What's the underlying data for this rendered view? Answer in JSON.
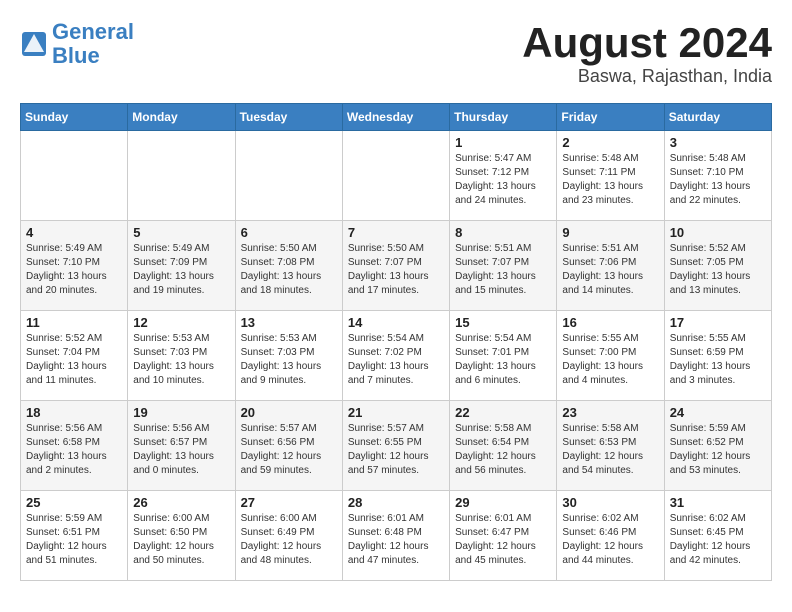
{
  "header": {
    "logo_line1": "General",
    "logo_line2": "Blue",
    "title": "August 2024",
    "subtitle": "Baswa, Rajasthan, India"
  },
  "weekdays": [
    "Sunday",
    "Monday",
    "Tuesday",
    "Wednesday",
    "Thursday",
    "Friday",
    "Saturday"
  ],
  "weeks": [
    [
      {
        "day": "",
        "info": ""
      },
      {
        "day": "",
        "info": ""
      },
      {
        "day": "",
        "info": ""
      },
      {
        "day": "",
        "info": ""
      },
      {
        "day": "1",
        "info": "Sunrise: 5:47 AM\nSunset: 7:12 PM\nDaylight: 13 hours\nand 24 minutes."
      },
      {
        "day": "2",
        "info": "Sunrise: 5:48 AM\nSunset: 7:11 PM\nDaylight: 13 hours\nand 23 minutes."
      },
      {
        "day": "3",
        "info": "Sunrise: 5:48 AM\nSunset: 7:10 PM\nDaylight: 13 hours\nand 22 minutes."
      }
    ],
    [
      {
        "day": "4",
        "info": "Sunrise: 5:49 AM\nSunset: 7:10 PM\nDaylight: 13 hours\nand 20 minutes."
      },
      {
        "day": "5",
        "info": "Sunrise: 5:49 AM\nSunset: 7:09 PM\nDaylight: 13 hours\nand 19 minutes."
      },
      {
        "day": "6",
        "info": "Sunrise: 5:50 AM\nSunset: 7:08 PM\nDaylight: 13 hours\nand 18 minutes."
      },
      {
        "day": "7",
        "info": "Sunrise: 5:50 AM\nSunset: 7:07 PM\nDaylight: 13 hours\nand 17 minutes."
      },
      {
        "day": "8",
        "info": "Sunrise: 5:51 AM\nSunset: 7:07 PM\nDaylight: 13 hours\nand 15 minutes."
      },
      {
        "day": "9",
        "info": "Sunrise: 5:51 AM\nSunset: 7:06 PM\nDaylight: 13 hours\nand 14 minutes."
      },
      {
        "day": "10",
        "info": "Sunrise: 5:52 AM\nSunset: 7:05 PM\nDaylight: 13 hours\nand 13 minutes."
      }
    ],
    [
      {
        "day": "11",
        "info": "Sunrise: 5:52 AM\nSunset: 7:04 PM\nDaylight: 13 hours\nand 11 minutes."
      },
      {
        "day": "12",
        "info": "Sunrise: 5:53 AM\nSunset: 7:03 PM\nDaylight: 13 hours\nand 10 minutes."
      },
      {
        "day": "13",
        "info": "Sunrise: 5:53 AM\nSunset: 7:03 PM\nDaylight: 13 hours\nand 9 minutes."
      },
      {
        "day": "14",
        "info": "Sunrise: 5:54 AM\nSunset: 7:02 PM\nDaylight: 13 hours\nand 7 minutes."
      },
      {
        "day": "15",
        "info": "Sunrise: 5:54 AM\nSunset: 7:01 PM\nDaylight: 13 hours\nand 6 minutes."
      },
      {
        "day": "16",
        "info": "Sunrise: 5:55 AM\nSunset: 7:00 PM\nDaylight: 13 hours\nand 4 minutes."
      },
      {
        "day": "17",
        "info": "Sunrise: 5:55 AM\nSunset: 6:59 PM\nDaylight: 13 hours\nand 3 minutes."
      }
    ],
    [
      {
        "day": "18",
        "info": "Sunrise: 5:56 AM\nSunset: 6:58 PM\nDaylight: 13 hours\nand 2 minutes."
      },
      {
        "day": "19",
        "info": "Sunrise: 5:56 AM\nSunset: 6:57 PM\nDaylight: 13 hours\nand 0 minutes."
      },
      {
        "day": "20",
        "info": "Sunrise: 5:57 AM\nSunset: 6:56 PM\nDaylight: 12 hours\nand 59 minutes."
      },
      {
        "day": "21",
        "info": "Sunrise: 5:57 AM\nSunset: 6:55 PM\nDaylight: 12 hours\nand 57 minutes."
      },
      {
        "day": "22",
        "info": "Sunrise: 5:58 AM\nSunset: 6:54 PM\nDaylight: 12 hours\nand 56 minutes."
      },
      {
        "day": "23",
        "info": "Sunrise: 5:58 AM\nSunset: 6:53 PM\nDaylight: 12 hours\nand 54 minutes."
      },
      {
        "day": "24",
        "info": "Sunrise: 5:59 AM\nSunset: 6:52 PM\nDaylight: 12 hours\nand 53 minutes."
      }
    ],
    [
      {
        "day": "25",
        "info": "Sunrise: 5:59 AM\nSunset: 6:51 PM\nDaylight: 12 hours\nand 51 minutes."
      },
      {
        "day": "26",
        "info": "Sunrise: 6:00 AM\nSunset: 6:50 PM\nDaylight: 12 hours\nand 50 minutes."
      },
      {
        "day": "27",
        "info": "Sunrise: 6:00 AM\nSunset: 6:49 PM\nDaylight: 12 hours\nand 48 minutes."
      },
      {
        "day": "28",
        "info": "Sunrise: 6:01 AM\nSunset: 6:48 PM\nDaylight: 12 hours\nand 47 minutes."
      },
      {
        "day": "29",
        "info": "Sunrise: 6:01 AM\nSunset: 6:47 PM\nDaylight: 12 hours\nand 45 minutes."
      },
      {
        "day": "30",
        "info": "Sunrise: 6:02 AM\nSunset: 6:46 PM\nDaylight: 12 hours\nand 44 minutes."
      },
      {
        "day": "31",
        "info": "Sunrise: 6:02 AM\nSunset: 6:45 PM\nDaylight: 12 hours\nand 42 minutes."
      }
    ]
  ]
}
